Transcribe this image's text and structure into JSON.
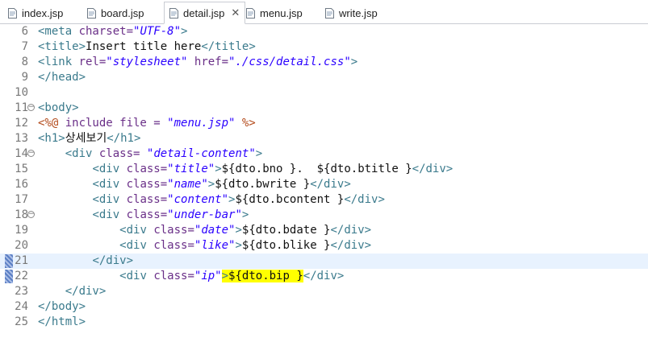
{
  "tabs": [
    {
      "label": "index.jsp",
      "active": false
    },
    {
      "label": "board.jsp",
      "active": false
    },
    {
      "label": "detail.jsp",
      "active": true
    },
    {
      "label": "menu.jsp",
      "active": false
    },
    {
      "label": "write.jsp",
      "active": false
    }
  ],
  "close_glyph": "✕",
  "lines": [
    {
      "n": "6",
      "fold": false,
      "parts": [
        [
          "tag",
          "<meta "
        ],
        [
          "attr",
          "charset="
        ],
        [
          "str",
          "\"UTF-8\""
        ],
        [
          "tag",
          ">"
        ]
      ]
    },
    {
      "n": "7",
      "fold": false,
      "parts": [
        [
          "tag",
          "<title>"
        ],
        [
          "txt",
          "Insert title here"
        ],
        [
          "tag",
          "</title>"
        ]
      ]
    },
    {
      "n": "8",
      "fold": false,
      "parts": [
        [
          "tag",
          "<link "
        ],
        [
          "attr",
          "rel="
        ],
        [
          "str",
          "\"stylesheet\""
        ],
        [
          "txt",
          " "
        ],
        [
          "attr",
          "href="
        ],
        [
          "str",
          "\"./css/detail.css\""
        ],
        [
          "tag",
          ">"
        ]
      ]
    },
    {
      "n": "9",
      "fold": false,
      "parts": [
        [
          "tag",
          "</head>"
        ]
      ]
    },
    {
      "n": "10",
      "fold": false,
      "parts": []
    },
    {
      "n": "11",
      "fold": true,
      "parts": [
        [
          "tag",
          "<body>"
        ]
      ]
    },
    {
      "n": "12",
      "fold": false,
      "parts": [
        [
          "jsp",
          "<%@ "
        ],
        [
          "attr",
          "include file = "
        ],
        [
          "str",
          "\"menu.jsp\""
        ],
        [
          "jsp",
          " %>"
        ]
      ]
    },
    {
      "n": "13",
      "fold": false,
      "parts": [
        [
          "tag",
          "<h1>"
        ],
        [
          "txt",
          "상세보기"
        ],
        [
          "tag",
          "</h1>"
        ]
      ]
    },
    {
      "n": "14",
      "fold": true,
      "parts": [
        [
          "txt",
          "    "
        ],
        [
          "tag",
          "<div "
        ],
        [
          "attr",
          "class= "
        ],
        [
          "str",
          "\"detail-content\""
        ],
        [
          "tag",
          ">"
        ]
      ]
    },
    {
      "n": "15",
      "fold": false,
      "parts": [
        [
          "txt",
          "        "
        ],
        [
          "tag",
          "<div "
        ],
        [
          "attr",
          "class="
        ],
        [
          "str",
          "\"title\""
        ],
        [
          "tag",
          ">"
        ],
        [
          "txt",
          "${dto.bno }.  ${dto.btitle }"
        ],
        [
          "tag",
          "</div>"
        ]
      ]
    },
    {
      "n": "16",
      "fold": false,
      "parts": [
        [
          "txt",
          "        "
        ],
        [
          "tag",
          "<div "
        ],
        [
          "attr",
          "class="
        ],
        [
          "str",
          "\"name\""
        ],
        [
          "tag",
          ">"
        ],
        [
          "txt",
          "${dto.bwrite }"
        ],
        [
          "tag",
          "</div>"
        ]
      ]
    },
    {
      "n": "17",
      "fold": false,
      "parts": [
        [
          "txt",
          "        "
        ],
        [
          "tag",
          "<div "
        ],
        [
          "attr",
          "class="
        ],
        [
          "str",
          "\"content\""
        ],
        [
          "tag",
          ">"
        ],
        [
          "txt",
          "${dto.bcontent }"
        ],
        [
          "tag",
          "</div>"
        ]
      ]
    },
    {
      "n": "18",
      "fold": true,
      "parts": [
        [
          "txt",
          "        "
        ],
        [
          "tag",
          "<div "
        ],
        [
          "attr",
          "class="
        ],
        [
          "str",
          "\"under-bar\""
        ],
        [
          "tag",
          ">"
        ]
      ]
    },
    {
      "n": "19",
      "fold": false,
      "parts": [
        [
          "txt",
          "            "
        ],
        [
          "tag",
          "<div "
        ],
        [
          "attr",
          "class="
        ],
        [
          "str",
          "\"date\""
        ],
        [
          "tag",
          ">"
        ],
        [
          "txt",
          "${dto.bdate }"
        ],
        [
          "tag",
          "</div>"
        ]
      ]
    },
    {
      "n": "20",
      "fold": false,
      "parts": [
        [
          "txt",
          "            "
        ],
        [
          "tag",
          "<div "
        ],
        [
          "attr",
          "class="
        ],
        [
          "str",
          "\"like\""
        ],
        [
          "tag",
          ">"
        ],
        [
          "txt",
          "${dto.blike }"
        ],
        [
          "tag",
          "</div>"
        ]
      ]
    },
    {
      "n": "21",
      "fold": false,
      "current": true,
      "parts": [
        [
          "txt",
          "        "
        ],
        [
          "tag",
          "</div>"
        ]
      ]
    },
    {
      "n": "22",
      "fold": false,
      "parts": [
        [
          "txt",
          "            "
        ],
        [
          "tag",
          "<div "
        ],
        [
          "attr",
          "class="
        ],
        [
          "str",
          "\"ip\""
        ],
        [
          "tagHL",
          ">"
        ],
        [
          "txtHL",
          "${dto.bip }"
        ],
        [
          "tag",
          "</div>"
        ]
      ]
    },
    {
      "n": "23",
      "fold": false,
      "parts": [
        [
          "txt",
          "    "
        ],
        [
          "tag",
          "</div>"
        ]
      ]
    },
    {
      "n": "24",
      "fold": false,
      "parts": [
        [
          "tag",
          "</body>"
        ]
      ]
    },
    {
      "n": "25",
      "fold": false,
      "parts": [
        [
          "tag",
          "</html>"
        ]
      ]
    }
  ]
}
